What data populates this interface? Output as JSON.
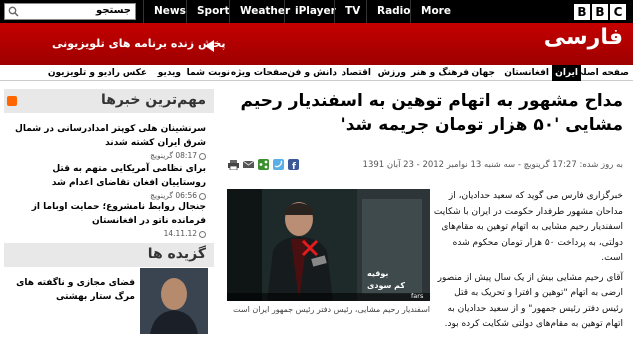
{
  "topbar": {
    "search_label": "جستجو",
    "nav": [
      "News",
      "Sport",
      "Weather",
      "iPlayer",
      "TV",
      "Radio",
      "More"
    ],
    "logo": [
      "B",
      "B",
      "C"
    ]
  },
  "banner": {
    "site_title": "فارسی",
    "live_tv": "پخش زنده برنامه های تلویزیونی"
  },
  "sections": [
    "صفحه اصلی",
    "ایران",
    "افغانستان",
    "جهان",
    "فرهنگ و هنر",
    "ورزش",
    "اقتصاد",
    "دانش و فن",
    "صفحات ویژه",
    "نوبت شما",
    "ویدیو",
    "عکس",
    "رادیو و تلویزیون"
  ],
  "article": {
    "headline": "مداح مشهور به اتهام توهین به اسفندیار رحیم مشایی '۵۰ هزار تومان جریمه شد'",
    "meta": "به روز شده: 17:27 گرینویچ - سه شنبه 13 نوامبر 2012 - 23 آبان 1391",
    "caption": "اسفندیار رحیم مشایی، رئیس دفتر رئیس جمهور ایران است",
    "photo_overlay": "رئیس دفتر رئیس جمهور ایران است",
    "photo_credit": "fars",
    "photo_label1": "بوقیه",
    "photo_label2": "کم سودی",
    "paragraphs": [
      "خبرگزاری فارس می گوید که سعید حدادیان، از مداحان مشهور طرفدار حکومت در ایران با شکایت اسفندیار رحیم مشایی به اتهام توهین به مقام‌های دولتی، به پرداخت ۵۰ هزار تومان محکوم شده است.",
      "آقای رحیم مشایی بیش از یک سال پیش از منصور ارضی به اتهام \"توهین و افترا و تحریک به قتل رئیس دفتر رئیس جمهور\" و از سعید حدادیان به اتهام توهین به مقام‌های دولتی شکایت کرده بود."
    ]
  },
  "sidebar": {
    "top_title": "مهم‌ترین خبرها",
    "items": [
      {
        "title": "سرنشینان هلی کوپتر امدادرسانی در شمال شرق ایران کشته شدند",
        "time": "08:17 گرینویچ"
      },
      {
        "title": "برای نظامی آمریکایی متهم به قتل روستاییان افغان تقاضای اعدام شد",
        "time": "06:56 گرینویچ"
      },
      {
        "title": "جنجال روابط نامشروع؛ حمایت اوباما از فرمانده ناتو در افغانستان",
        "time": "14.11.12"
      }
    ],
    "picks_title": "گزیده ها",
    "picks_text": "فضای مجازی و ناگفته های مرگ ستار بهشتی"
  }
}
